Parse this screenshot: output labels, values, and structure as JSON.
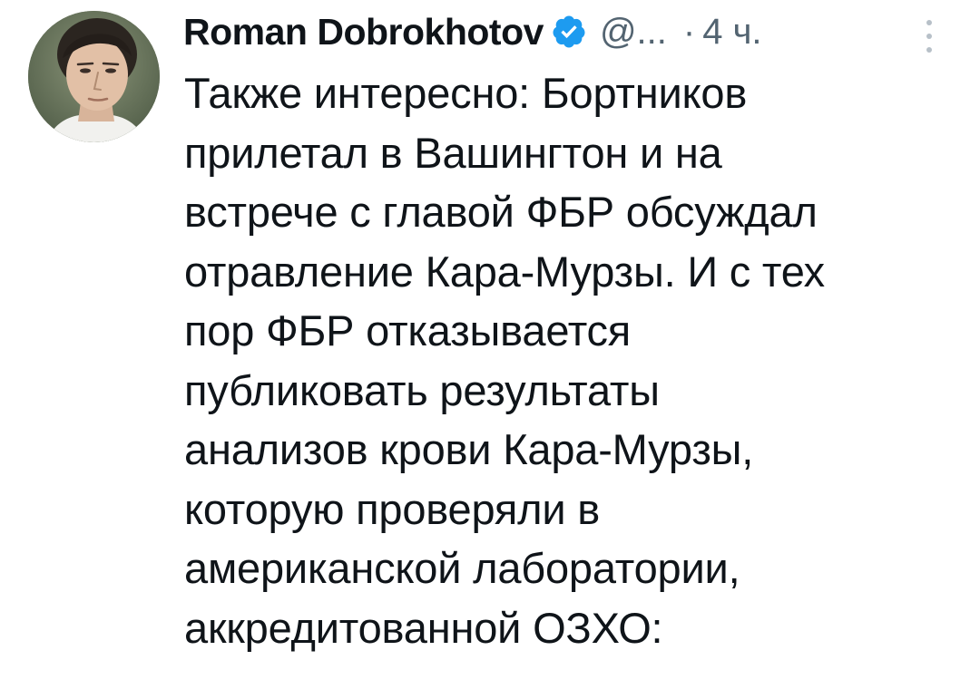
{
  "tweet": {
    "author_name": "Roman Dobrokhotov",
    "handle": "@...",
    "separator": "·",
    "time": "4 ч.",
    "verified_icon": "verified-badge-icon",
    "more_icon": "more-vertical-icon",
    "text_lines": [
      "Также интересно: Бортников",
      "прилетал в Вашингтон и на",
      "встрече с главой ФБР обсуждал",
      "отравление Кара-Мурзы. И с тех",
      "пор ФБР отказывается",
      "публиковать результаты",
      "анализов крови Кара-Мурзы,",
      "которую проверяли в",
      "американской лаборатории,",
      "аккредитованной ОЗХО:"
    ]
  },
  "colors": {
    "text_primary": "#0f1419",
    "text_secondary": "#536471",
    "verified_blue": "#1d9bf0",
    "background": "#ffffff"
  }
}
